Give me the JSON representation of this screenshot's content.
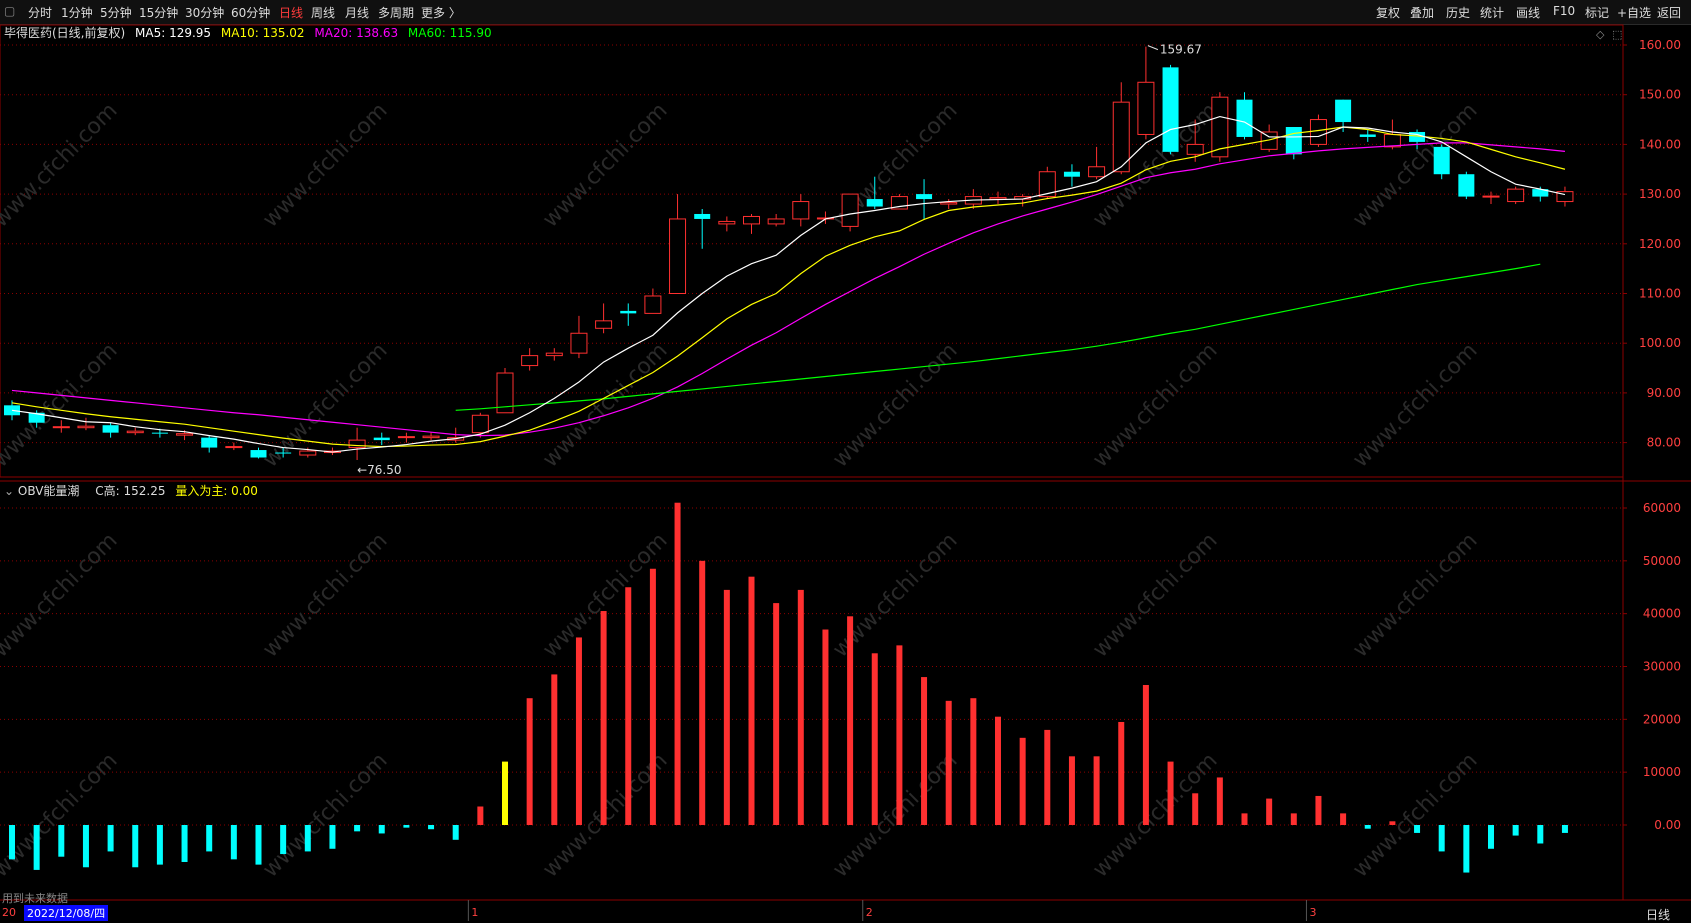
{
  "toolbar": {
    "tabs": [
      "分时",
      "1分钟",
      "5分钟",
      "15分钟",
      "30分钟",
      "60分钟",
      "日线",
      "周线",
      "月线",
      "多周期",
      "更多 〉"
    ],
    "active_tab": "日线",
    "right_buttons": [
      "复权",
      "叠加",
      "历史",
      "统计",
      "画线",
      "F10",
      "标记",
      "+自选",
      "返回"
    ]
  },
  "price_panel": {
    "legend": {
      "name": "毕得医药(日线,前复权)",
      "ma5": "MA5: 129.95",
      "ma10": "MA10: 135.02",
      "ma20": "MA20: 138.63",
      "ma60": "MA60: 115.90"
    },
    "high_marker": "159.67",
    "low_marker": "76.50"
  },
  "obv_panel": {
    "legend": {
      "name": "OBV能量潮",
      "c_high": "C高: 152.25",
      "volume_lead": "量入为主: 0.00"
    }
  },
  "bottom": {
    "note": "用到未来数据",
    "date_start": "20",
    "date_label": "2022/12/08/四",
    "month_labels": [
      "1",
      "2",
      "3"
    ],
    "period_label": "日线"
  },
  "watermark": "www.cfchi.com",
  "colors": {
    "up": "#ff3030",
    "down": "#00ffff",
    "ma5": "#ffffff",
    "ma10": "#ffff00",
    "ma20": "#ff00ff",
    "ma60": "#00ff00",
    "obv_highlight": "#ffff00",
    "gridline": "#8b0000"
  },
  "chart_data": [
    {
      "type": "candlestick",
      "ylim": [
        75,
        162
      ],
      "yticks": [
        "160.00",
        "150.00",
        "140.00",
        "130.00",
        "120.00",
        "110.00",
        "100.00",
        "90.00",
        "80.00"
      ],
      "candles": [
        {
          "o": 87.5,
          "c": 85.5,
          "h": 88.5,
          "l": 84.5
        },
        {
          "o": 86.0,
          "c": 84.0,
          "h": 86.5,
          "l": 83.0
        },
        {
          "o": 83.0,
          "c": 83.2,
          "h": 84.5,
          "l": 82.0
        },
        {
          "o": 83.0,
          "c": 83.3,
          "h": 85.0,
          "l": 82.5
        },
        {
          "o": 83.5,
          "c": 82.0,
          "h": 84.0,
          "l": 81.0
        },
        {
          "o": 82.0,
          "c": 82.3,
          "h": 83.0,
          "l": 81.5
        },
        {
          "o": 82.0,
          "c": 81.8,
          "h": 82.8,
          "l": 81.0
        },
        {
          "o": 81.5,
          "c": 81.8,
          "h": 82.5,
          "l": 80.5
        },
        {
          "o": 81.0,
          "c": 79.0,
          "h": 81.5,
          "l": 78.0
        },
        {
          "o": 79.0,
          "c": 79.2,
          "h": 80.0,
          "l": 78.5
        },
        {
          "o": 78.5,
          "c": 77.0,
          "h": 79.0,
          "l": 76.8
        },
        {
          "o": 78.0,
          "c": 77.8,
          "h": 79.0,
          "l": 77.0
        },
        {
          "o": 77.5,
          "c": 78.3,
          "h": 79.0,
          "l": 77.0
        },
        {
          "o": 78.0,
          "c": 78.3,
          "h": 79.0,
          "l": 77.5
        },
        {
          "o": 79.0,
          "c": 80.5,
          "h": 83.0,
          "l": 76.5
        },
        {
          "o": 81.0,
          "c": 80.5,
          "h": 82.0,
          "l": 79.5
        },
        {
          "o": 81.0,
          "c": 81.2,
          "h": 82.0,
          "l": 80.0
        },
        {
          "o": 81.0,
          "c": 81.3,
          "h": 82.0,
          "l": 80.5
        },
        {
          "o": 80.5,
          "c": 81.0,
          "h": 83.0,
          "l": 80.0
        },
        {
          "o": 82.0,
          "c": 85.5,
          "h": 86.0,
          "l": 81.0
        },
        {
          "o": 86.0,
          "c": 94.0,
          "h": 95.0,
          "l": 86.0
        },
        {
          "o": 95.5,
          "c": 97.5,
          "h": 99.0,
          "l": 94.5
        },
        {
          "o": 97.5,
          "c": 98.0,
          "h": 99.0,
          "l": 96.5
        },
        {
          "o": 98.0,
          "c": 102.0,
          "h": 105.5,
          "l": 97.0
        },
        {
          "o": 103.0,
          "c": 104.5,
          "h": 108.0,
          "l": 102.0
        },
        {
          "o": 106.5,
          "c": 106.0,
          "h": 108.0,
          "l": 103.5
        },
        {
          "o": 106.0,
          "c": 109.5,
          "h": 111.0,
          "l": 106.0
        },
        {
          "o": 110.0,
          "c": 125.0,
          "h": 130.0,
          "l": 110.0
        },
        {
          "o": 126.0,
          "c": 125.0,
          "h": 127.0,
          "l": 119.0
        },
        {
          "o": 124.0,
          "c": 124.5,
          "h": 125.5,
          "l": 122.5
        },
        {
          "o": 124.0,
          "c": 125.5,
          "h": 126.0,
          "l": 122.0
        },
        {
          "o": 124.0,
          "c": 125.0,
          "h": 126.0,
          "l": 123.5
        },
        {
          "o": 125.0,
          "c": 128.5,
          "h": 130.0,
          "l": 123.5
        },
        {
          "o": 125.0,
          "c": 125.2,
          "h": 126.5,
          "l": 124.0
        },
        {
          "o": 123.5,
          "c": 130.0,
          "h": 130.0,
          "l": 122.5
        },
        {
          "o": 129.0,
          "c": 127.5,
          "h": 133.5,
          "l": 127.0
        },
        {
          "o": 127.0,
          "c": 129.5,
          "h": 130.0,
          "l": 127.0
        },
        {
          "o": 130.0,
          "c": 129.0,
          "h": 133.0,
          "l": 125.0
        },
        {
          "o": 128.0,
          "c": 128.3,
          "h": 129.0,
          "l": 127.0
        },
        {
          "o": 128.0,
          "c": 129.5,
          "h": 131.0,
          "l": 127.0
        },
        {
          "o": 129.0,
          "c": 129.3,
          "h": 130.5,
          "l": 128.0
        },
        {
          "o": 129.0,
          "c": 129.5,
          "h": 130.0,
          "l": 127.5
        },
        {
          "o": 129.5,
          "c": 134.5,
          "h": 135.5,
          "l": 129.0
        },
        {
          "o": 134.5,
          "c": 133.5,
          "h": 136.0,
          "l": 131.5
        },
        {
          "o": 133.5,
          "c": 135.5,
          "h": 139.5,
          "l": 133.0
        },
        {
          "o": 134.5,
          "c": 148.5,
          "h": 152.5,
          "l": 134.0
        },
        {
          "o": 142.0,
          "c": 152.5,
          "h": 159.67,
          "l": 141.0
        },
        {
          "o": 155.5,
          "c": 138.5,
          "h": 156.0,
          "l": 138.0
        },
        {
          "o": 138.0,
          "c": 140.0,
          "h": 145.0,
          "l": 136.5
        },
        {
          "o": 137.5,
          "c": 149.5,
          "h": 150.5,
          "l": 136.5
        },
        {
          "o": 149.0,
          "c": 141.5,
          "h": 150.5,
          "l": 141.0
        },
        {
          "o": 139.0,
          "c": 142.5,
          "h": 144.0,
          "l": 138.5
        },
        {
          "o": 143.5,
          "c": 138.0,
          "h": 143.5,
          "l": 137.0
        },
        {
          "o": 140.0,
          "c": 145.0,
          "h": 146.0,
          "l": 139.5
        },
        {
          "o": 149.0,
          "c": 144.5,
          "h": 149.0,
          "l": 142.5
        },
        {
          "o": 142.0,
          "c": 141.5,
          "h": 143.0,
          "l": 140.5
        },
        {
          "o": 139.5,
          "c": 142.0,
          "h": 145.0,
          "l": 139.0
        },
        {
          "o": 142.5,
          "c": 140.5,
          "h": 143.0,
          "l": 139.0
        },
        {
          "o": 139.5,
          "c": 134.0,
          "h": 140.0,
          "l": 133.0
        },
        {
          "o": 134.0,
          "c": 129.5,
          "h": 134.5,
          "l": 129.0
        },
        {
          "o": 129.5,
          "c": 129.6,
          "h": 130.5,
          "l": 128.0
        },
        {
          "o": 128.5,
          "c": 131.0,
          "h": 131.5,
          "l": 128.0
        },
        {
          "o": 131.0,
          "c": 129.5,
          "h": 131.5,
          "l": 128.5
        },
        {
          "o": 128.5,
          "c": 130.5,
          "h": 131.5,
          "l": 127.5
        }
      ],
      "ma5": [
        86.5,
        85.8,
        85.0,
        84.2,
        84.0,
        83.2,
        82.6,
        82.2,
        81.4,
        80.7,
        79.8,
        79.0,
        78.6,
        78.1,
        78.7,
        79.1,
        79.6,
        80.3,
        80.8,
        81.7,
        83.5,
        86.0,
        88.9,
        92.2,
        96.2,
        99.0,
        101.6,
        106.1,
        110.0,
        113.5,
        116.0,
        117.7,
        121.7,
        125.0,
        126.0,
        126.7,
        127.5,
        128.1,
        128.5,
        128.8,
        128.9,
        129.0,
        130.1,
        131.2,
        132.5,
        135.5,
        140.3,
        143.0,
        144.0,
        145.6,
        144.5,
        141.5,
        141.5,
        141.6,
        143.5,
        143.3,
        142.5,
        142.0,
        140.5,
        137.5,
        134.5,
        132.0,
        131.0,
        129.9
      ],
      "ma10": [
        88.0,
        87.2,
        86.5,
        85.8,
        85.2,
        84.7,
        84.2,
        83.7,
        83.0,
        82.3,
        81.6,
        80.9,
        80.3,
        79.7,
        79.4,
        79.2,
        79.3,
        79.5,
        79.6,
        80.2,
        81.3,
        82.5,
        84.3,
        86.3,
        88.9,
        91.5,
        94.1,
        97.4,
        101.1,
        104.9,
        107.8,
        110.0,
        114.0,
        117.5,
        119.7,
        121.4,
        122.6,
        124.9,
        126.7,
        127.4,
        127.8,
        128.2,
        129.1,
        129.8,
        130.6,
        132.2,
        134.9,
        136.6,
        137.5,
        139.1,
        140.0,
        140.9,
        142.2,
        142.8,
        143.5,
        143.0,
        142.0,
        141.7,
        141.2,
        140.5,
        139.0,
        137.5,
        136.3,
        135.0
      ],
      "ma20": [
        90.5,
        90.0,
        89.5,
        89.0,
        88.5,
        88.0,
        87.5,
        87.0,
        86.5,
        86.0,
        85.6,
        85.1,
        84.6,
        84.1,
        83.6,
        83.1,
        82.6,
        82.1,
        81.6,
        81.4,
        81.5,
        82.1,
        82.9,
        84.0,
        85.4,
        87.0,
        88.9,
        91.2,
        93.9,
        96.8,
        99.6,
        102.1,
        105.0,
        107.8,
        110.4,
        113.0,
        115.4,
        117.9,
        120.1,
        122.2,
        124.0,
        125.6,
        127.0,
        128.4,
        129.9,
        131.6,
        133.3,
        134.3,
        135.0,
        136.1,
        136.9,
        137.7,
        138.2,
        138.7,
        139.1,
        139.4,
        139.7,
        140.0,
        140.3,
        140.3,
        139.9,
        139.5,
        139.1,
        138.6
      ],
      "ma60_start": 18,
      "ma60": [
        86.5,
        86.8,
        87.2,
        87.6,
        88.0,
        88.4,
        88.8,
        89.3,
        89.8,
        90.3,
        90.8,
        91.3,
        91.8,
        92.3,
        92.8,
        93.3,
        93.8,
        94.3,
        94.8,
        95.3,
        95.8,
        96.3,
        96.9,
        97.5,
        98.1,
        98.7,
        99.4,
        100.2,
        101.1,
        102.0,
        102.8,
        103.8,
        104.8,
        105.8,
        106.8,
        107.8,
        108.8,
        109.8,
        110.8,
        111.8,
        112.6,
        113.4,
        114.2,
        115.0,
        115.9
      ],
      "high_marker_index": 46,
      "low_marker_index": 14
    },
    {
      "type": "bar",
      "name": "OBV能量潮",
      "ylim": [
        -10000,
        62000
      ],
      "yticks": [
        "60000",
        "50000",
        "40000",
        "30000",
        "20000",
        "10000",
        "0.00"
      ],
      "values": [
        -6500,
        -8500,
        -6000,
        -8000,
        -5000,
        -8000,
        -7500,
        -7000,
        -5000,
        -6500,
        -7500,
        -5500,
        -5000,
        -4500,
        -1200,
        -1600,
        -500,
        -800,
        -2800,
        3500,
        12000,
        24000,
        28500,
        35500,
        40500,
        45000,
        48500,
        61000,
        50000,
        44500,
        47000,
        42000,
        44500,
        37000,
        39500,
        32500,
        34000,
        28000,
        23500,
        24000,
        20500,
        16500,
        18000,
        13000,
        13000,
        19500,
        26500,
        12000,
        6000,
        9000,
        2200,
        5000,
        2200,
        5500,
        2200,
        -700,
        700,
        -1500,
        -5000,
        -9000,
        -4500,
        -2000,
        -3500,
        -1500
      ],
      "highlight_index": 20
    }
  ]
}
